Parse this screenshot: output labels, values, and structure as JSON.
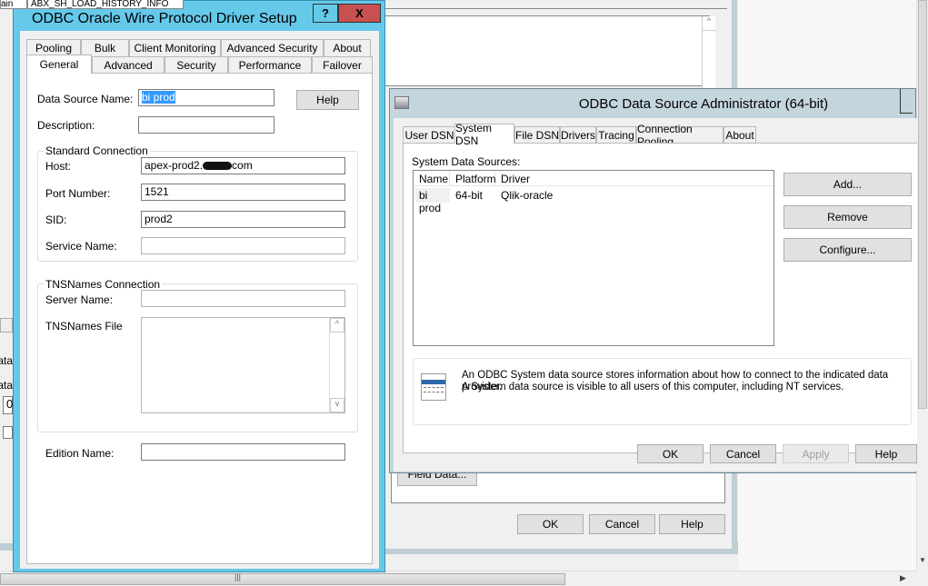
{
  "background_window": {
    "top_left_text": "ain",
    "top_field_text": "ABX_SH_LOAD_HISTORY_INFO",
    "left_labels": [
      "ata",
      "ata"
    ],
    "left_field_value": "0",
    "field_data_button": "Field Data...",
    "ok": "OK",
    "cancel": "Cancel",
    "help": "Help"
  },
  "oracle_dialog": {
    "title": "ODBC Oracle Wire Protocol Driver Setup",
    "help_glyph": "?",
    "close_glyph": "X",
    "tabs_row1": [
      "Pooling",
      "Bulk",
      "Client Monitoring",
      "Advanced Security",
      "About"
    ],
    "tabs_row2": [
      "General",
      "Advanced",
      "Security",
      "Performance",
      "Failover"
    ],
    "selected_tab": "General",
    "data_source_name_label": "Data Source Name:",
    "data_source_name_value": "bi prod",
    "description_label": "Description:",
    "description_value": "",
    "help_button": "Help",
    "standard_connection": {
      "title": "Standard Connection",
      "host_label": "Host:",
      "host_value": "apex-prod2.",
      "host_suffix": "com",
      "port_label": "Port Number:",
      "port_value": "1521",
      "sid_label": "SID:",
      "sid_value": "prod2",
      "service_label": "Service Name:",
      "service_value": ""
    },
    "tnsnames_connection": {
      "title": "TNSNames Connection",
      "server_label": "Server Name:",
      "server_value": "",
      "file_label": "TNSNames File",
      "file_value": ""
    },
    "edition_label": "Edition Name:",
    "edition_value": ""
  },
  "admin_dialog": {
    "title": "ODBC Data Source Administrator (64-bit)",
    "tabs": [
      "User DSN",
      "System DSN",
      "File DSN",
      "Drivers",
      "Tracing",
      "Connection Pooling",
      "About"
    ],
    "selected_tab": "System DSN",
    "list_label": "System Data Sources:",
    "columns": [
      "Name",
      "Platform",
      "Driver"
    ],
    "rows": [
      [
        "bi prod",
        "64-bit",
        "Qlik-oracle"
      ]
    ],
    "buttons": [
      "Add...",
      "Remove",
      "Configure..."
    ],
    "info_line1": "An ODBC System data source stores information about how to connect to the indicated data provider.",
    "info_line2": "A System data source is visible to all users of this computer, including NT services.",
    "ok": "OK",
    "cancel": "Cancel",
    "apply": "Apply",
    "help": "Help"
  },
  "colors": {
    "oracle_title_bar": "#65c9ea",
    "close_button": "#c75050",
    "admin_title_bar": "#c3d5dd",
    "selection": "#3399ff"
  }
}
